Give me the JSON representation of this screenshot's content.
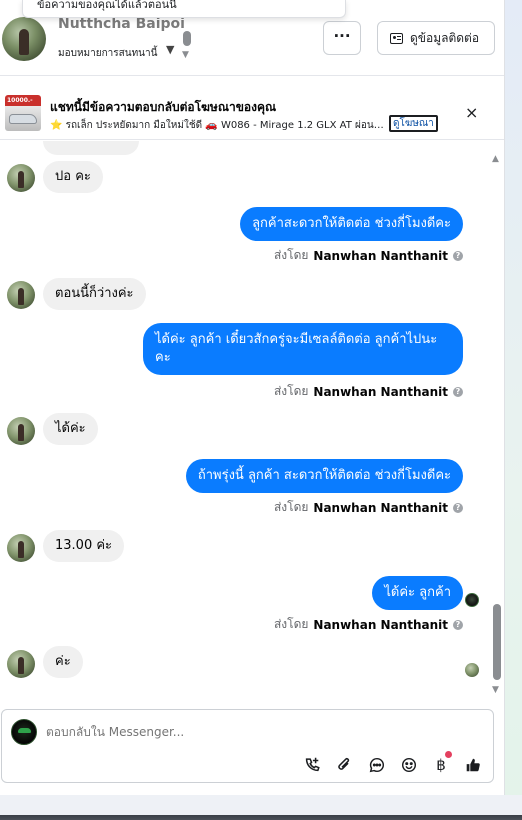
{
  "tooltip": {
    "text": "ข้อความของคุณได้แล้วตอนนี้"
  },
  "header": {
    "contact_name": "Nutthcha Baipoi",
    "subtitle": "มอบหมายการสนทนานี้",
    "more_label": "···",
    "contact_info_label": "ดูข้อมูลติดต่อ"
  },
  "ad": {
    "thumb_text": "10000.-",
    "title": "แชทนี้มีข้อความตอบกลับต่อโฆษณาของคุณ",
    "subtitle": "⭐ รถเล็ก ประหยัดมาก มือใหม่ใช้ดี 🚗 W086 - Mirage 1.2 GLX AT ผ่อน ...",
    "link_label": "ดูโฆษณา",
    "close_label": "×"
  },
  "messages": [
    {
      "dir": "in",
      "text": "ปอ  คะ"
    },
    {
      "dir": "out",
      "text": "ลูกค้าสะดวกให้ติดต่อ ช่วงกี่โมงดีคะ",
      "sender": "Nanwhan Nanthanit"
    },
    {
      "dir": "in",
      "text": "ตอนนี้ก็ว่างค่ะ"
    },
    {
      "dir": "out",
      "text": "ได้ค่ะ  ลูกค้า  เดี๋ยวสักครู่จะมีเซลล์ติดต่อ ลูกค้าไปนะคะ",
      "sender": "Nanwhan Nanthanit"
    },
    {
      "dir": "in",
      "text": "ได้ค่ะ"
    },
    {
      "dir": "out",
      "text": "ถ้าพรุ่งนี้ ลูกค้า สะดวกให้ติดต่อ ช่วงกี่โมงดีคะ",
      "sender": "Nanwhan Nanthanit"
    },
    {
      "dir": "in",
      "text": "13.00 ค่ะ"
    },
    {
      "dir": "out",
      "text": "ได้ค่ะ  ลูกค้า",
      "sender": "Nanwhan Nanthanit"
    },
    {
      "dir": "in",
      "text": "ค่ะ"
    }
  ],
  "sent_by_prefix": "ส่งโดย",
  "composer": {
    "placeholder": "ตอบกลับใน Messenger...",
    "tools": [
      "call-add-icon",
      "attachment-icon",
      "saved-reply-icon",
      "emoji-icon",
      "payment-icon",
      "like-icon"
    ]
  }
}
